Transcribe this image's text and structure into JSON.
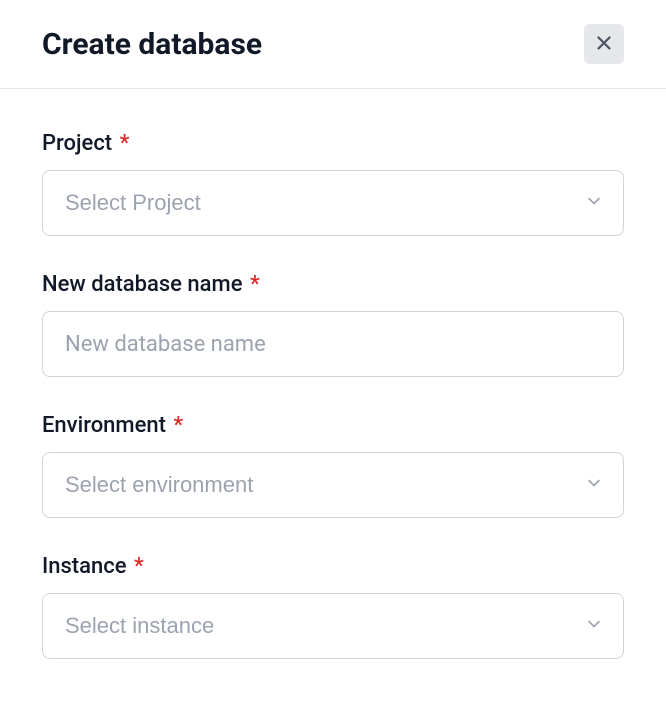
{
  "modal": {
    "title": "Create database"
  },
  "form": {
    "project": {
      "label": "Project",
      "placeholder": "Select Project"
    },
    "database_name": {
      "label": "New database name",
      "placeholder": "New database name",
      "value": ""
    },
    "environment": {
      "label": "Environment",
      "placeholder": "Select environment"
    },
    "instance": {
      "label": "Instance",
      "placeholder": "Select instance"
    },
    "required_mark": "*"
  }
}
